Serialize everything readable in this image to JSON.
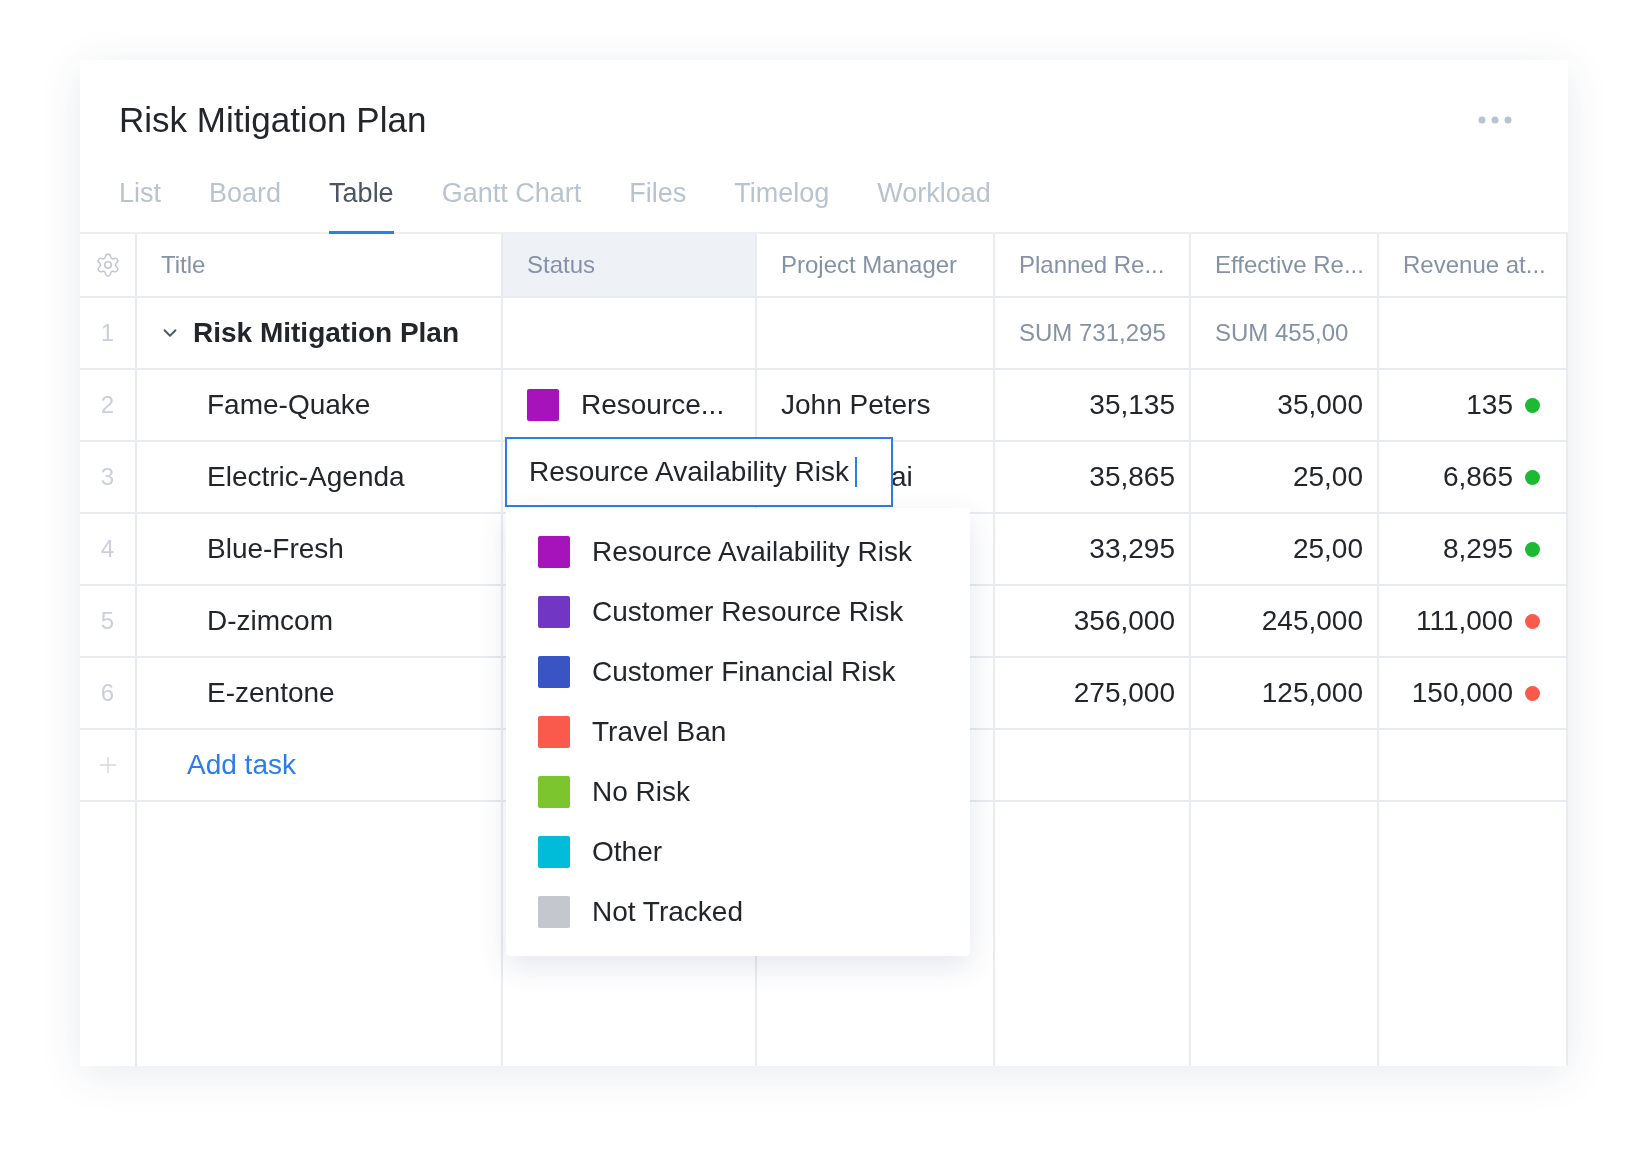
{
  "title": "Risk Mitigation Plan",
  "tabs": [
    {
      "label": "List",
      "selected": false
    },
    {
      "label": "Board",
      "selected": false
    },
    {
      "label": "Table",
      "selected": true
    },
    {
      "label": "Gantt Chart",
      "selected": false
    },
    {
      "label": "Files",
      "selected": false
    },
    {
      "label": "Timelog",
      "selected": false
    },
    {
      "label": "Workload",
      "selected": false
    }
  ],
  "columns": [
    {
      "label": "Title",
      "selected": false
    },
    {
      "label": "Status",
      "selected": true
    },
    {
      "label": "Project Manager",
      "selected": false
    },
    {
      "label": "Planned Re...",
      "selected": false
    },
    {
      "label": "Effective Re...",
      "selected": false
    },
    {
      "label": "Revenue at...",
      "selected": false
    }
  ],
  "rows": [
    {
      "kind": "group",
      "number": "1",
      "title": "Risk Mitigation Plan",
      "expanded": true,
      "planned": "SUM 731,295",
      "effective": "SUM 455,00"
    },
    {
      "kind": "task",
      "number": "2",
      "title": "Fame-Quake",
      "status": {
        "label": "Resource...",
        "color": "#a713bb"
      },
      "manager": "John Peters",
      "planned": "35,135",
      "effective": "35,000",
      "revenue": "135",
      "color": "#1bb934"
    },
    {
      "kind": "task",
      "number": "3",
      "title": "Electric-Agenda",
      "editing": true,
      "manager": "ai",
      "planned": "35,865",
      "effective": "25,00",
      "revenue": "6,865",
      "color": "#1bb934"
    },
    {
      "kind": "task",
      "number": "4",
      "title": "Blue-Fresh",
      "planned": "33,295",
      "effective": "25,00",
      "revenue": "8,295",
      "color": "#1bb934"
    },
    {
      "kind": "task",
      "number": "5",
      "title": "D-zimcom",
      "planned": "356,000",
      "effective": "245,000",
      "revenue": "111,000",
      "color": "#fa5a4b"
    },
    {
      "kind": "task",
      "number": "6",
      "title": "E-zentone",
      "planned": "275,000",
      "effective": "125,000",
      "revenue": "150,000",
      "color": "#fa5a4b"
    }
  ],
  "add_task": "Add task",
  "status_editor": {
    "value": "Resource Availability Risk"
  },
  "status_options": [
    {
      "label": "Resource Availability Risk",
      "color": "#a713bb"
    },
    {
      "label": "Customer Resource Risk",
      "color": "#7136c4"
    },
    {
      "label": "Customer Financial Risk",
      "color": "#3b54c4"
    },
    {
      "label": "Travel Ban",
      "color": "#fa5a4b"
    },
    {
      "label": "No Risk",
      "color": "#7dc52e"
    },
    {
      "label": "Other",
      "color": "#00bcd9"
    },
    {
      "label": "Not Tracked",
      "color": "#c4c7ce"
    }
  ]
}
